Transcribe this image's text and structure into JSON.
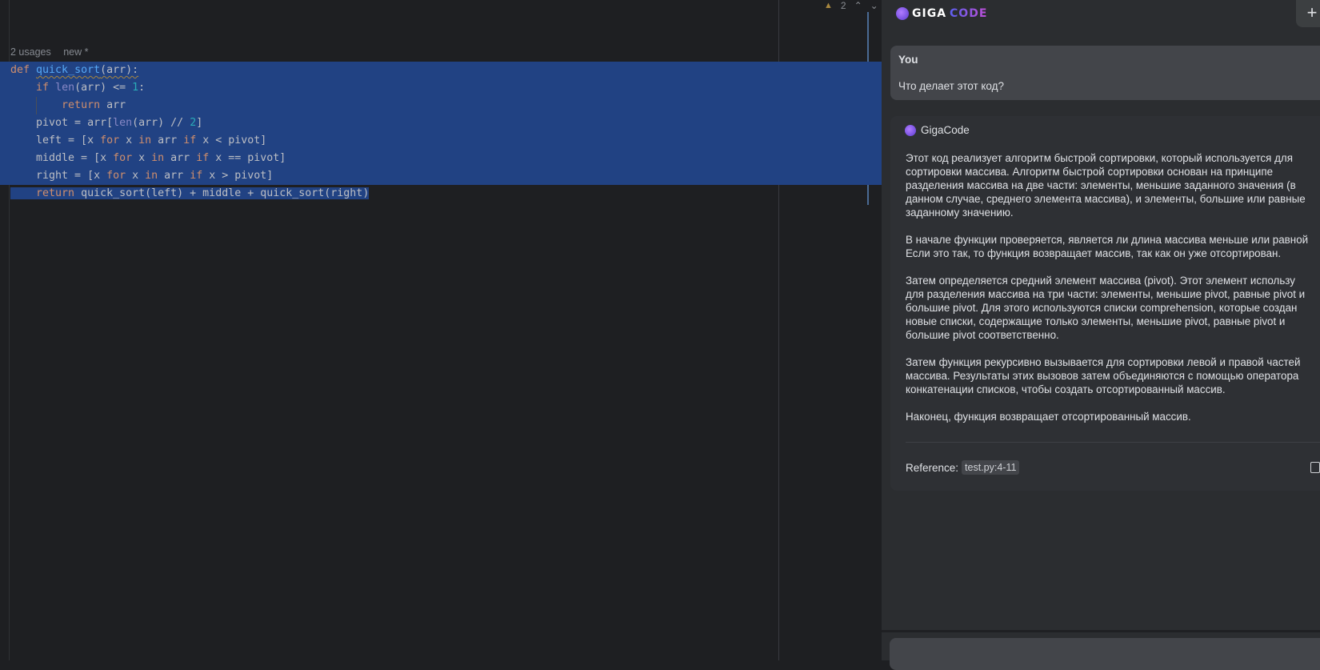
{
  "editor": {
    "inspections": {
      "warning_count": "2"
    },
    "hints": [
      "2 usages",
      "new *"
    ],
    "lines": [
      [
        [
          "kw",
          "def "
        ],
        [
          "fn sq",
          "quick_sort"
        ],
        [
          "sq",
          "(arr):"
        ]
      ],
      [
        [
          "",
          "    "
        ],
        [
          "kw",
          "if "
        ],
        [
          "bi",
          "len"
        ],
        [
          "",
          "(arr) <= "
        ],
        [
          "num",
          "1"
        ],
        [
          "",
          ":"
        ]
      ],
      [
        [
          "",
          "        "
        ],
        [
          "kw",
          "return "
        ],
        [
          "",
          "arr"
        ]
      ],
      [
        [
          "",
          "    pivot = arr["
        ],
        [
          "bi",
          "len"
        ],
        [
          "",
          "(arr) // "
        ],
        [
          "num",
          "2"
        ],
        [
          "",
          "]"
        ]
      ],
      [
        [
          "",
          "    left = [x "
        ],
        [
          "kw",
          "for "
        ],
        [
          "",
          "x "
        ],
        [
          "kw",
          "in "
        ],
        [
          "",
          "arr "
        ],
        [
          "kw",
          "if "
        ],
        [
          "",
          "x < pivot]"
        ]
      ],
      [
        [
          "",
          "    middle = [x "
        ],
        [
          "kw",
          "for "
        ],
        [
          "",
          "x "
        ],
        [
          "kw",
          "in "
        ],
        [
          "",
          "arr "
        ],
        [
          "kw",
          "if "
        ],
        [
          "",
          "x == pivot]"
        ]
      ],
      [
        [
          "",
          "    right = [x "
        ],
        [
          "kw",
          "for "
        ],
        [
          "",
          "x "
        ],
        [
          "kw",
          "in "
        ],
        [
          "",
          "arr "
        ],
        [
          "kw",
          "if "
        ],
        [
          "",
          "x > pivot]"
        ]
      ],
      [
        [
          "",
          "    "
        ],
        [
          "kw",
          "return "
        ],
        [
          "",
          "quick_sort(left) + middle + quick_sort(right)"
        ]
      ]
    ]
  },
  "assistant": {
    "logo_left": "GIGA",
    "logo_right": "CODE",
    "new_chat": "+",
    "user": {
      "name": "You",
      "message": "Что делает этот код?"
    },
    "reply": {
      "name": "GigaCode",
      "lines": [
        "Этот код реализует алгоритм быстрой сортировки, который используется для",
        "сортировки массива. Алгоритм быстрой сортировки основан на принципе",
        "разделения массива на две части: элементы, меньшие заданного значения (в",
        "данном случае, среднего элемента массива), и элементы, большие или равные",
        "заданному значению.",
        "",
        "В начале функции проверяется, является ли длина массива меньше или равной",
        "Если это так, то функция возвращает массив, так как он уже отсортирован.",
        "",
        "Затем определяется средний элемент массива (pivot). Этот элемент использу",
        "для разделения массива на три части: элементы, меньшие pivot, равные pivot и",
        "большие pivot. Для этого используются списки comprehension, которые создан",
        "новые списки, содержащие только элементы, меньшие pivot, равные pivot и",
        "большие pivot соответственно.",
        "",
        "Затем функция рекурсивно вызывается для сортировки левой и правой частей",
        "массива. Результаты этих вызовов затем объединяются с помощью оператора",
        "конкатенации списков, чтобы создать отсортированный массив.",
        "",
        "Наконец, функция возвращает отсортированный массив."
      ],
      "reference_label": "Reference:",
      "reference_chip": "test.py:4-11"
    }
  },
  "colors": {
    "selection": "#214283",
    "keyword": "#cf8e6d",
    "function": "#56a8f5",
    "number": "#2aacb8"
  }
}
